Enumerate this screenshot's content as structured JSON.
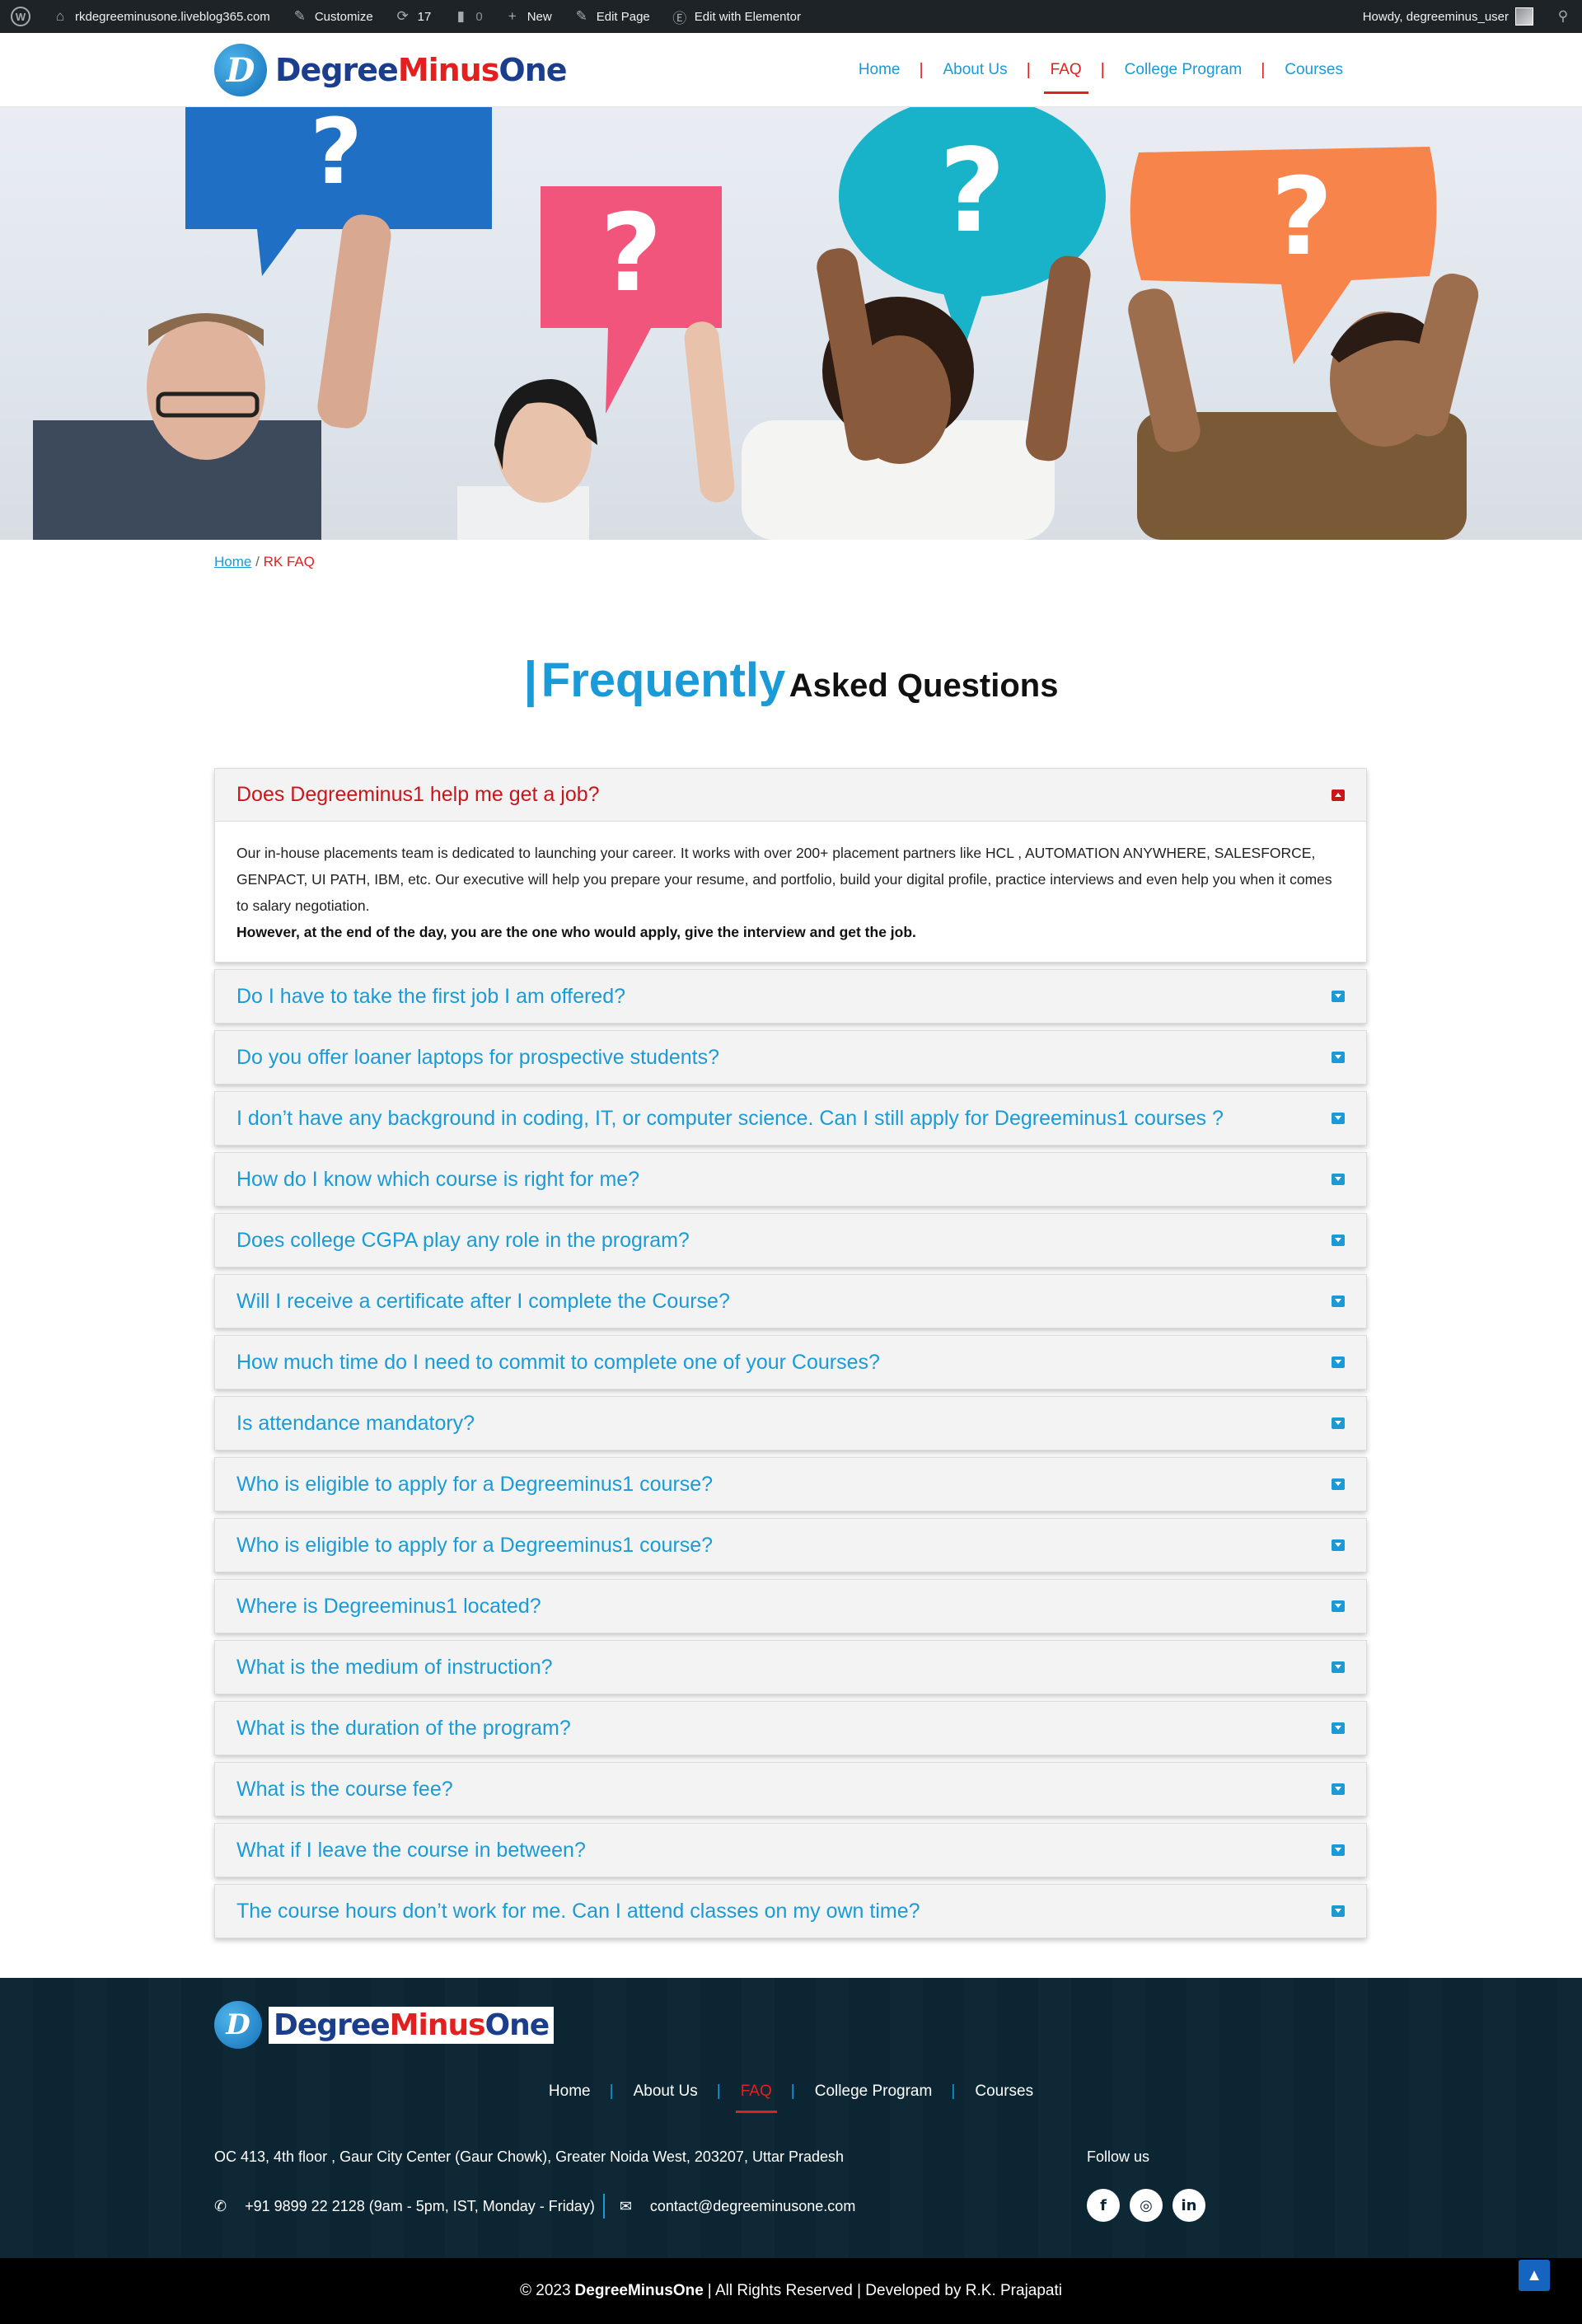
{
  "adminbar": {
    "site": "rkdegreeminusone.liveblog365.com",
    "customize": "Customize",
    "updates": "17",
    "comments": "0",
    "new": "New",
    "edit_page": "Edit Page",
    "edit_elementor": "Edit with Elementor",
    "howdy": "Howdy, degreeminus_user"
  },
  "header": {
    "logo_a": "Degree",
    "logo_b": "Minus",
    "logo_c": "One",
    "nav": [
      "Home",
      "About Us",
      "FAQ",
      "College Program",
      "Courses"
    ],
    "active": "FAQ"
  },
  "breadcrumb": {
    "home": "Home",
    "sep": "/",
    "current": "RK FAQ"
  },
  "title": {
    "bar": "|",
    "main": "Frequently",
    "sub": "Asked Questions"
  },
  "faq": {
    "open": {
      "question": "Does Degreeminus1 help me get a job?",
      "answer": "Our in-house placements team is dedicated to launching your career. It works with over 200+ placement partners like HCL , AUTOMATION ANYWHERE, SALESFORCE, GENPACT, UI PATH, IBM, etc. Our executive will help you prepare your resume, and portfolio, build your digital profile, practice interviews and even help you when it comes to salary negotiation.",
      "answer_bold": "However, at the end of the day, you are the one who would apply, give the interview and get the job."
    },
    "items": [
      "Do I have to take the first job I am offered?",
      "Do you offer loaner laptops for prospective students?",
      "I don’t have any background in coding, IT, or computer science. Can I still apply for Degreeminus1 courses ?",
      "How do I know which course is right for me?",
      "Does college CGPA play any role in the program?",
      "Will I receive a certificate after I complete the Course?",
      "How much time do I need to commit to complete one of your Courses?",
      "Is attendance mandatory?",
      "Who is eligible to apply for a Degreeminus1 course?",
      "Who is eligible to apply for a Degreeminus1 course?",
      "Where is Degreeminus1 located?",
      "What is the medium of instruction?",
      "What is the duration of the program?",
      "What is the course fee?",
      "What if I leave the course in between?",
      "The course hours don’t work for me. Can I attend classes on my own time?"
    ]
  },
  "footer": {
    "nav": [
      "Home",
      "About Us",
      "FAQ",
      "College Program",
      "Courses"
    ],
    "address": "OC 413, 4th floor , Gaur City Center (Gaur Chowk), Greater Noida West, 203207, Uttar Pradesh",
    "phone": "+91 9899 22 2128 (9am - 5pm, IST, Monday - Friday)",
    "email": "contact@degreeminusone.com",
    "follow": "Follow us",
    "social": [
      "facebook-icon",
      "instagram-icon",
      "linkedin-icon"
    ]
  },
  "copyright": {
    "year": "© 2023",
    "brand": "DegreeMinusOne",
    "rights": "| All Rights Reserved | Developed by R.K. Prajapati"
  },
  "colors": {
    "accent": "#1a9ad6",
    "brand_red": "#e2201f",
    "footer_bg": "#0b2533"
  }
}
